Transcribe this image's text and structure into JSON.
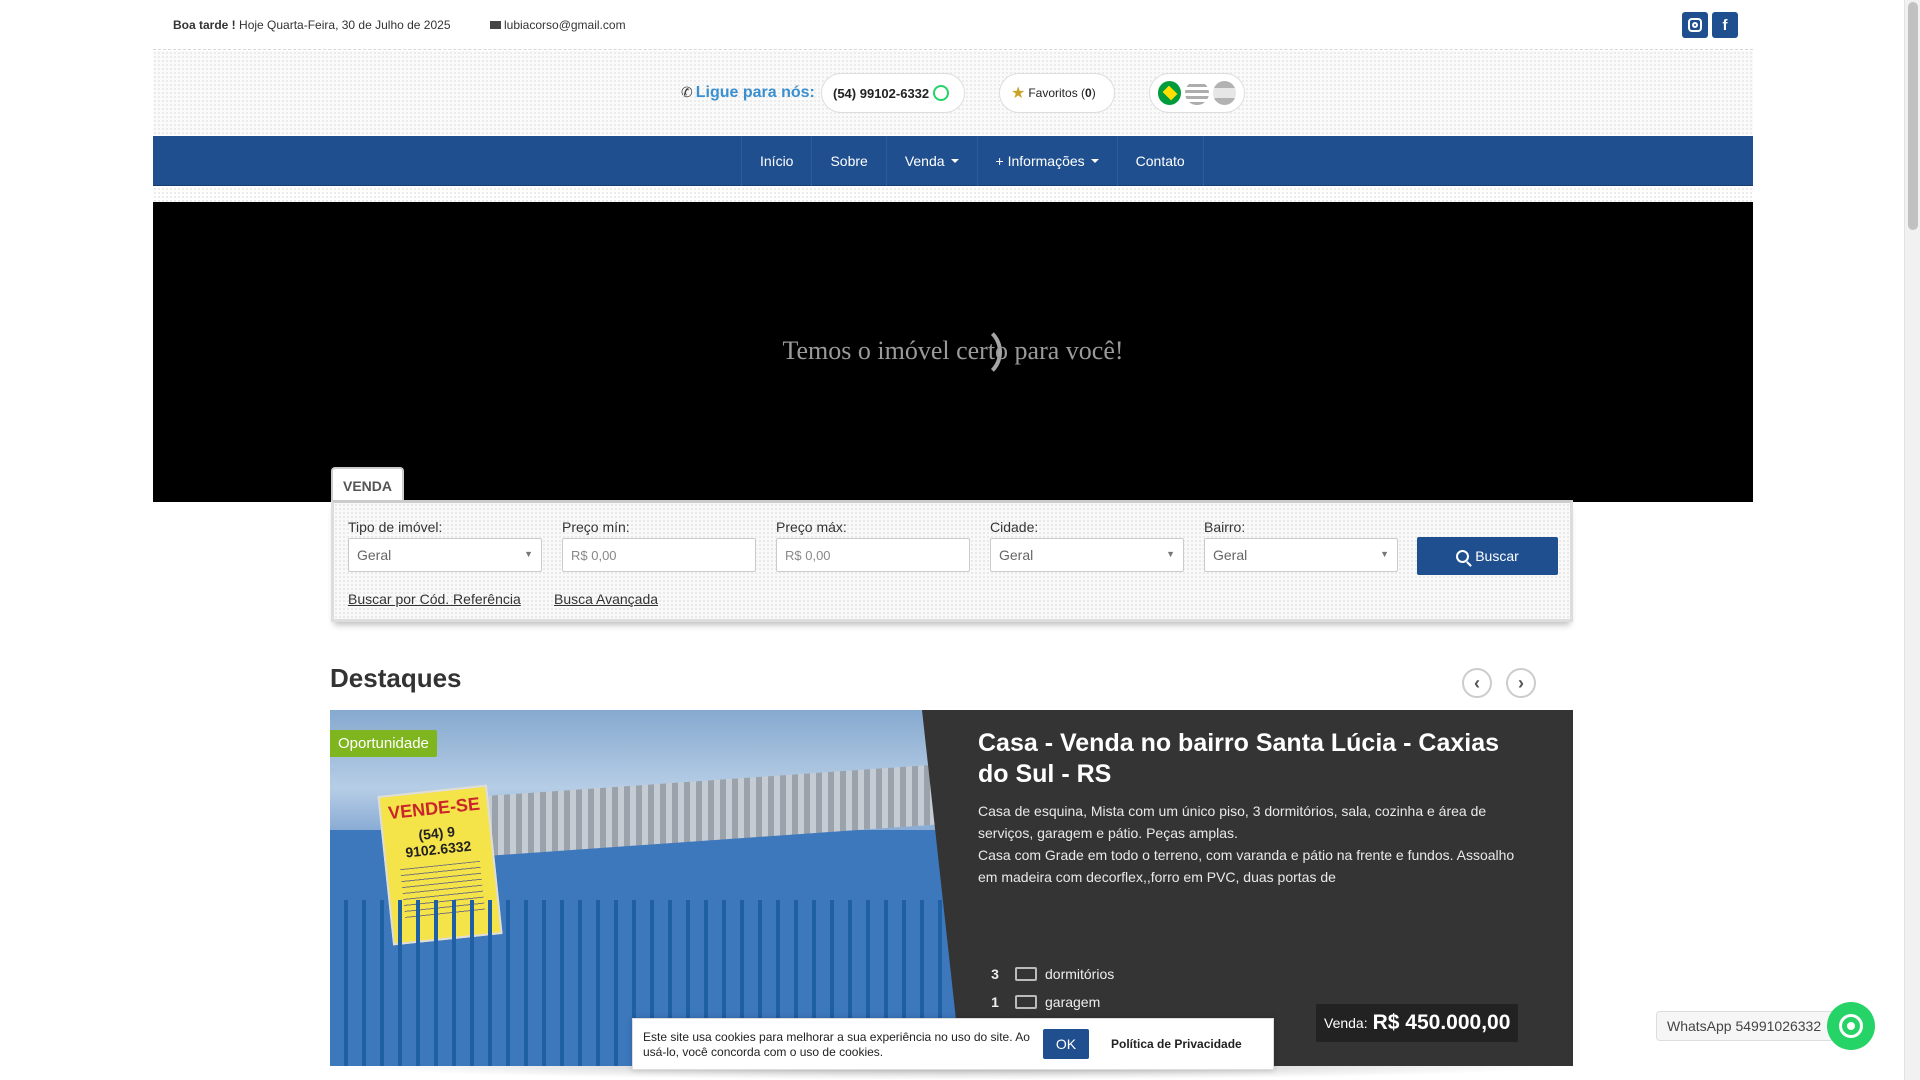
{
  "topbar": {
    "greeting_bold": "Boa tarde !",
    "greeting_date": "Hoje Quarta-Feira, 30 de Julho de 2025",
    "email": "lubiacorso@gmail.com",
    "social": [
      {
        "icon": "instagram-icon",
        "label": ""
      },
      {
        "icon": "facebook-icon",
        "label": "f"
      }
    ]
  },
  "header": {
    "call_label": "Ligue para nós:",
    "phone": "(54) 99102-6332",
    "favorites_label": "Favoritos (",
    "favorites_count": "0",
    "favorites_close": ")",
    "flags": [
      "brazil-flag-icon",
      "uruguay-flag-icon",
      "spain-flag-icon"
    ]
  },
  "nav": {
    "items": [
      "Início",
      "Sobre",
      "Venda",
      "+ Informações",
      "Contato"
    ]
  },
  "hero": {
    "title": "Temos o imóvel certo para você!"
  },
  "search": {
    "tab": "VENDA",
    "tipo_label": "Tipo de imóvel:",
    "tipo_value": "Geral",
    "preco_min_label": "Preço mín:",
    "preco_min_placeholder": "R$ 0,00",
    "preco_max_label": "Preço máx:",
    "preco_max_placeholder": "R$ 0,00",
    "cidade_label": "Cidade:",
    "cidade_value": "Geral",
    "bairro_label": "Bairro:",
    "bairro_value": "Geral",
    "buscar_label": "Buscar",
    "cod_ref_link": "Buscar por Cód. Referência",
    "avancada_link": "Busca Avançada"
  },
  "destaques": {
    "title": "Destaques",
    "prev": "‹",
    "next": "›",
    "card": {
      "badge": "Oportunidade",
      "sign_text": "VENDE-SE",
      "sign_phone": "(54) 9 9102.6332",
      "title": "Casa - Venda no bairro Santa Lúcia - Caxias do Sul - RS",
      "desc1": "Casa de esquina, Mista com um único piso, 3 dormitórios, sala, cozinha e área de serviços, garagem e pátio. Peças amplas.",
      "desc2": "Casa com Grade em todo o terreno, com varanda e pátio na frente e fundos. Assoalho em madeira com decorflex,,forro em PVC, duas portas de",
      "features": [
        {
          "num": "3",
          "label": "dormitórios",
          "icon": "bed-icon"
        },
        {
          "num": "1",
          "label": "garagem",
          "icon": "car-icon"
        }
      ],
      "price_label": "Venda:",
      "price_value": "R$ 450.000,00"
    }
  },
  "cookie": {
    "text": "Este site usa cookies para melhorar a sua experiência no uso do site. Ao usá-lo, você concorda com o uso de cookies.",
    "ok": "OK",
    "privacy": "Política de Privacidade"
  },
  "whatsapp": {
    "label": "WhatsApp 54991026332"
  }
}
